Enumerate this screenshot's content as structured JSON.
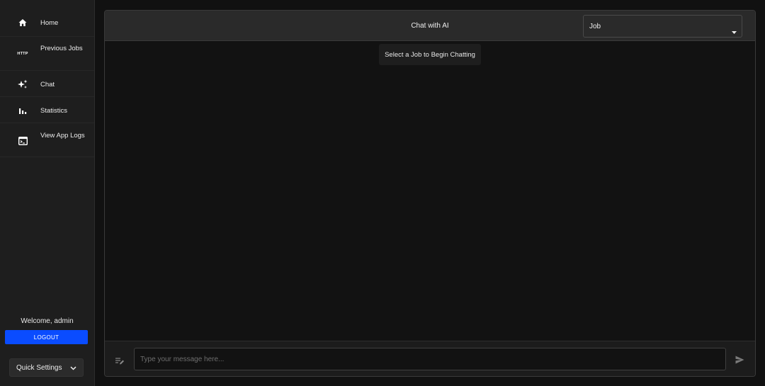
{
  "sidebar": {
    "items": [
      {
        "label": "Home",
        "icon": "home-icon"
      },
      {
        "label": "Previous Jobs",
        "icon": "http-icon",
        "icon_text": "HTTP"
      },
      {
        "label": "Chat",
        "icon": "sparkle-icon"
      },
      {
        "label": "Statistics",
        "icon": "bar-chart-icon"
      },
      {
        "label": "View App Logs",
        "icon": "terminal-icon"
      }
    ],
    "welcome": "Welcome, admin",
    "logout_label": "LOGOUT",
    "quick_settings_label": "Quick Settings"
  },
  "chat": {
    "title": "Chat with AI",
    "job_select": {
      "value": "Job"
    },
    "empty_hint": "Select a Job to Begin Chatting",
    "input": {
      "placeholder": "Type your message here...",
      "value": ""
    }
  },
  "colors": {
    "accent": "#0a4cff",
    "background": "#111111",
    "sidebar": "#1e1e1e",
    "header": "#2a2a2a"
  }
}
